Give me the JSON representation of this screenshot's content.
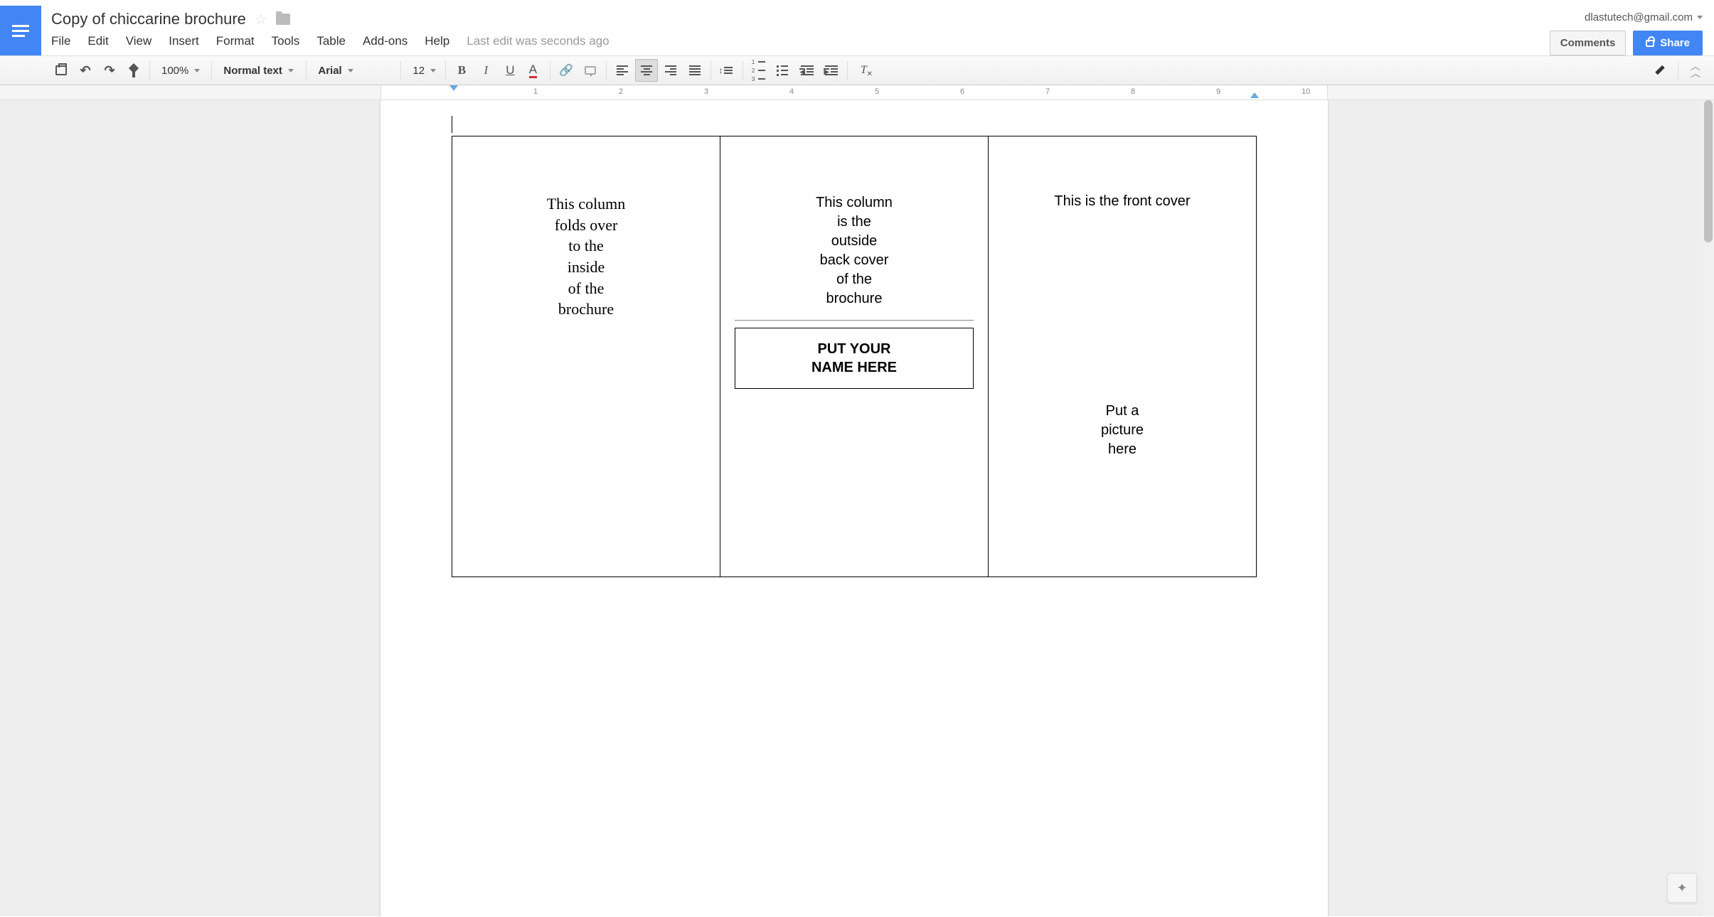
{
  "header": {
    "doc_title": "Copy of chiccarine brochure",
    "user_email": "dlastutech@gmail.com",
    "last_edit": "Last edit was seconds ago",
    "comments_btn": "Comments",
    "share_btn": "Share"
  },
  "menu": {
    "file": "File",
    "edit": "Edit",
    "view": "View",
    "insert": "Insert",
    "format": "Format",
    "tools": "Tools",
    "table": "Table",
    "addons": "Add-ons",
    "help": "Help"
  },
  "toolbar": {
    "zoom": "100%",
    "style": "Normal text",
    "font": "Arial",
    "size": "12",
    "bold": "B",
    "italic": "I",
    "underline": "U",
    "textcolor": "A"
  },
  "ruler": {
    "marks": [
      "1",
      "2",
      "3",
      "4",
      "5",
      "6",
      "7",
      "8",
      "9",
      "10"
    ]
  },
  "document": {
    "col1": {
      "l1": "This column",
      "l2": "folds over",
      "l3": "to the",
      "l4": "inside",
      "l5": "of the",
      "l6": "brochure"
    },
    "col2": {
      "l1": "This column",
      "l2": "is the",
      "l3": "outside",
      "l4": "back cover",
      "l5": "of the",
      "l6": "brochure",
      "name1": "PUT YOUR",
      "name2": "NAME HERE"
    },
    "col3": {
      "title": "This is the front cover",
      "pic1": "Put a",
      "pic2": "picture",
      "pic3": "here"
    }
  }
}
